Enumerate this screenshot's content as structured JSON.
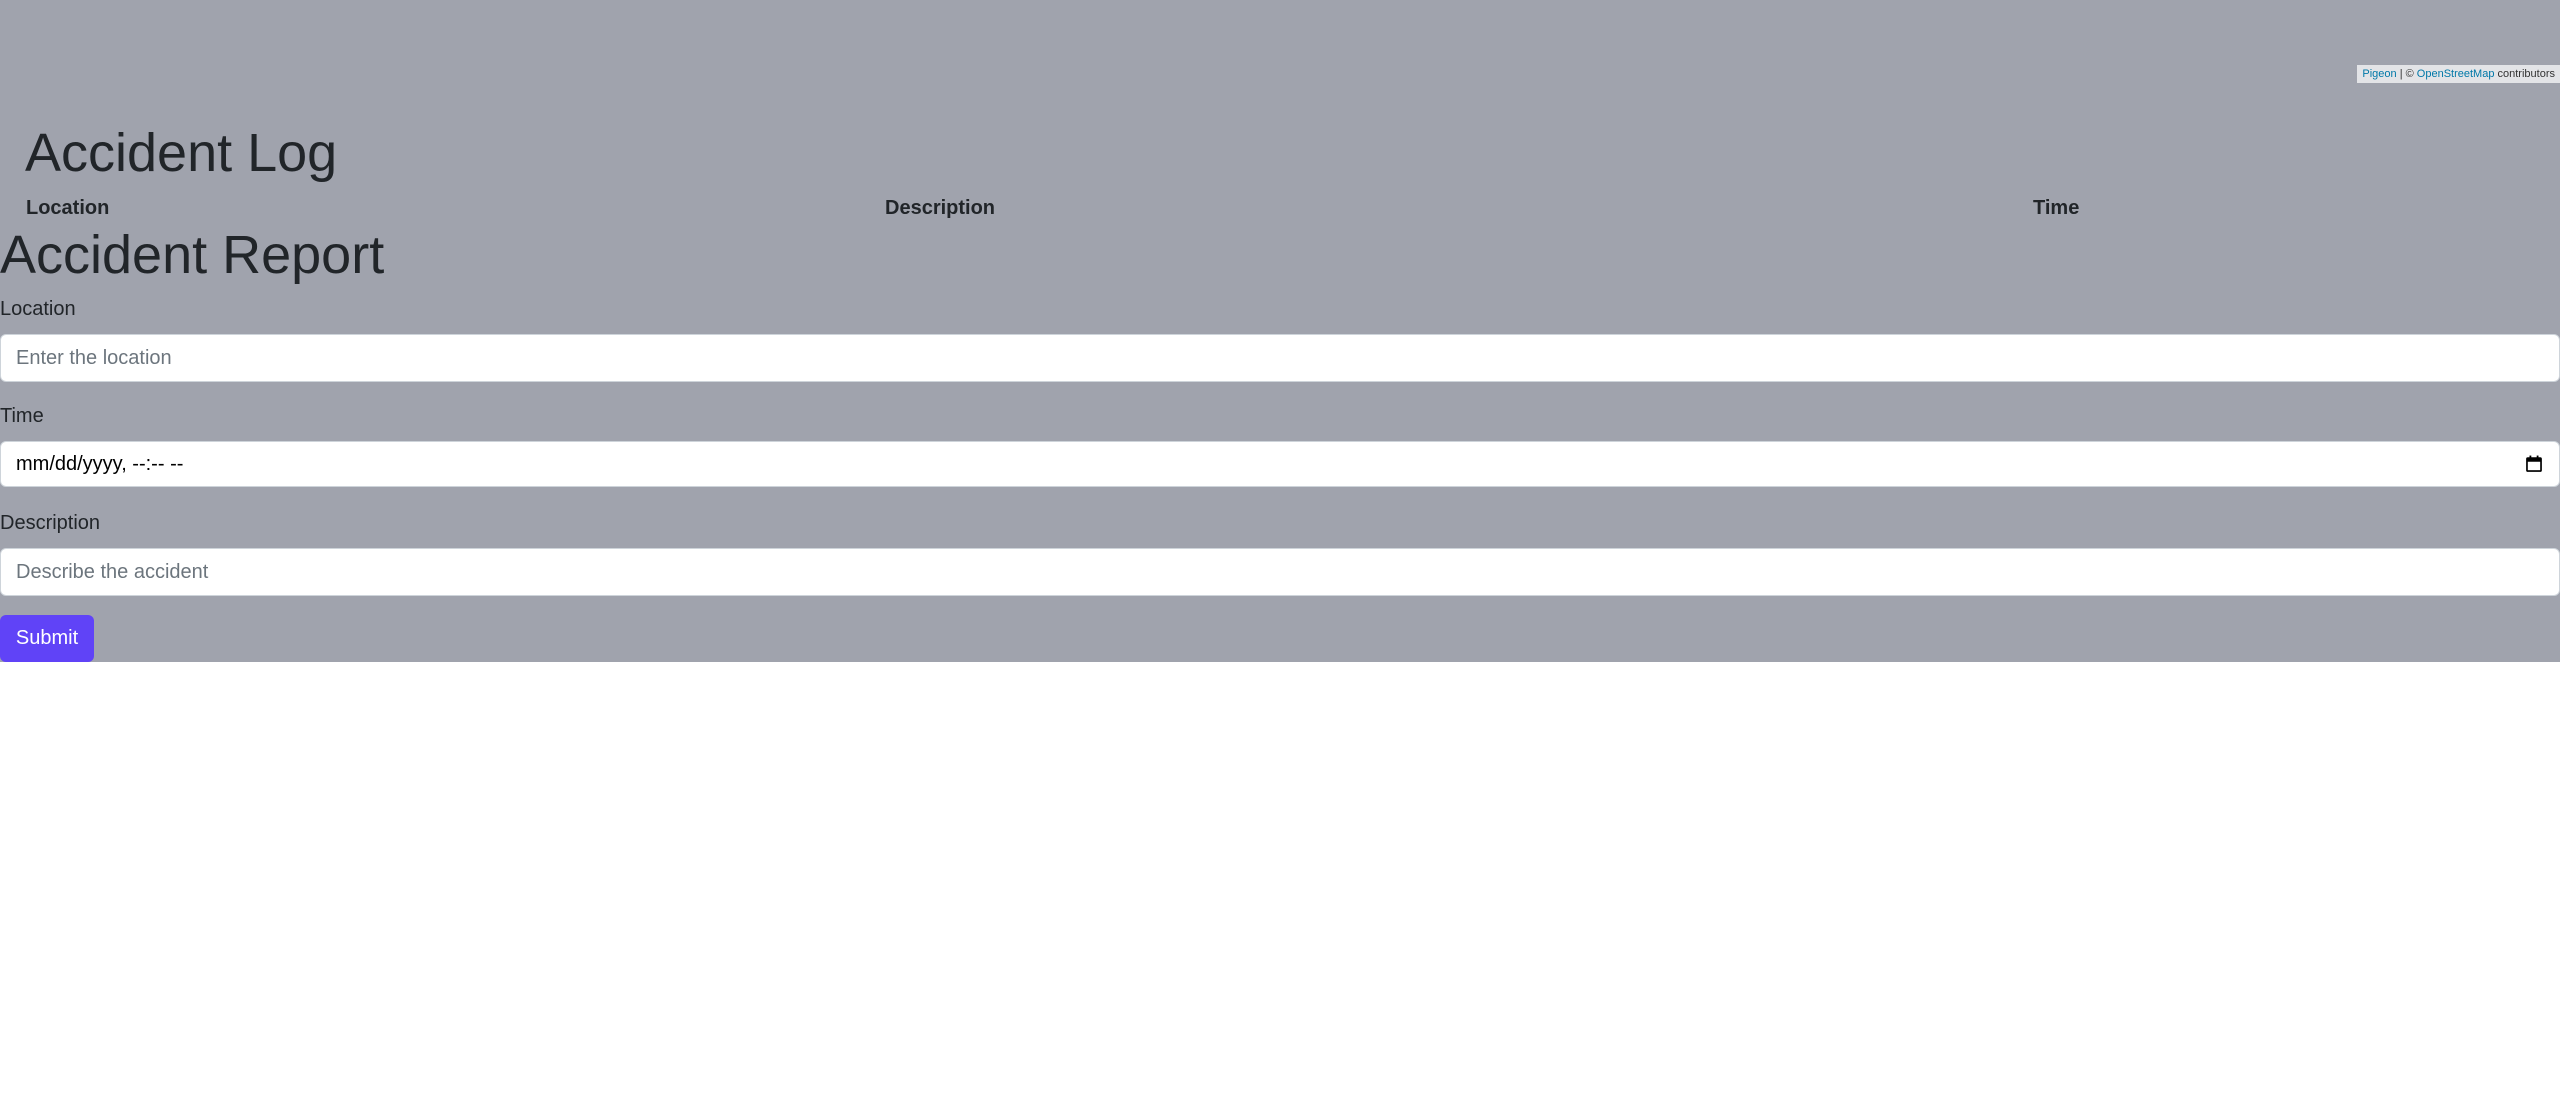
{
  "map": {
    "attribution": {
      "provider_link": "Pigeon",
      "separator": "| ©",
      "osm_link": "OpenStreetMap",
      "suffix": "contributors"
    }
  },
  "log": {
    "title": "Accident Log",
    "columns": [
      "Location",
      "Description",
      "Time"
    ]
  },
  "report": {
    "title": "Accident Report",
    "location": {
      "label": "Location",
      "placeholder": "Enter the location",
      "value": ""
    },
    "time": {
      "label": "Time",
      "display": "mm/dd/yyyy, --:-- --"
    },
    "description": {
      "label": "Description",
      "placeholder": "Describe the accident",
      "value": ""
    },
    "submit_label": "Submit"
  },
  "colors": {
    "overlay_bg": "#a0a3ad",
    "submit_bg": "#6043f7",
    "text": "#212529",
    "link": "#0078a8"
  },
  "icons": {
    "datetime_picker": "calendar-icon"
  }
}
